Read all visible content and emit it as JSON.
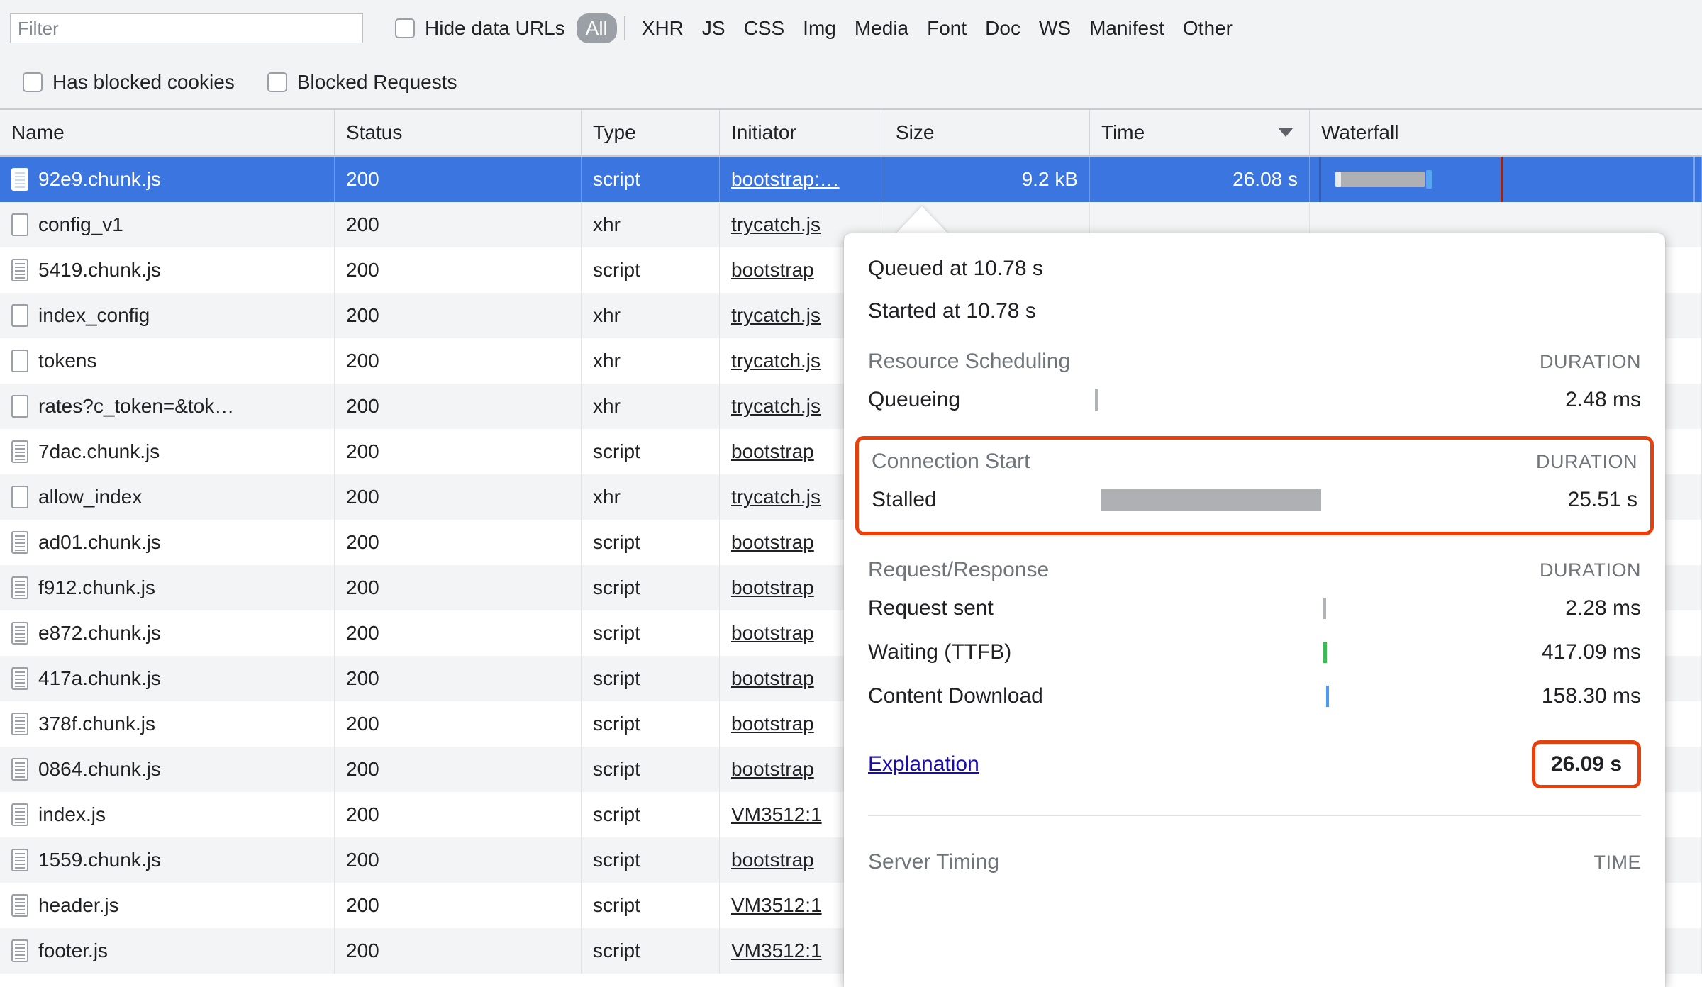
{
  "toolbar": {
    "filter": {
      "placeholder": "Filter",
      "value": ""
    },
    "hide_data_urls_label": "Hide data URLs",
    "type_filters": [
      "All",
      "XHR",
      "JS",
      "CSS",
      "Img",
      "Media",
      "Font",
      "Doc",
      "WS",
      "Manifest",
      "Other"
    ],
    "active_type_filter": "All",
    "has_blocked_cookies_label": "Has blocked cookies",
    "blocked_requests_label": "Blocked Requests"
  },
  "table": {
    "columns": [
      "Name",
      "Status",
      "Type",
      "Initiator",
      "Size",
      "Time",
      "Waterfall"
    ],
    "sorted_column": "Time",
    "sort_direction": "descending",
    "rows": [
      {
        "name": "92e9.chunk.js",
        "status": "200",
        "type": "script",
        "initiator": "bootstrap:…",
        "size": "9.2 kB",
        "time": "26.08 s",
        "icon": "script-file-icon",
        "selected": true
      },
      {
        "name": "config_v1",
        "status": "200",
        "type": "xhr",
        "initiator": "trycatch.js",
        "size": "",
        "time": "",
        "icon": "blank-file-icon",
        "selected": false
      },
      {
        "name": "5419.chunk.js",
        "status": "200",
        "type": "script",
        "initiator": "bootstrap",
        "size": "",
        "time": "",
        "icon": "script-file-icon",
        "selected": false
      },
      {
        "name": "index_config",
        "status": "200",
        "type": "xhr",
        "initiator": "trycatch.js",
        "size": "",
        "time": "",
        "icon": "blank-file-icon",
        "selected": false
      },
      {
        "name": "tokens",
        "status": "200",
        "type": "xhr",
        "initiator": "trycatch.js",
        "size": "",
        "time": "",
        "icon": "blank-file-icon",
        "selected": false
      },
      {
        "name": "rates?c_token=&tok…",
        "status": "200",
        "type": "xhr",
        "initiator": "trycatch.js",
        "size": "",
        "time": "",
        "icon": "blank-file-icon",
        "selected": false
      },
      {
        "name": "7dac.chunk.js",
        "status": "200",
        "type": "script",
        "initiator": "bootstrap",
        "size": "",
        "time": "",
        "icon": "script-file-icon",
        "selected": false
      },
      {
        "name": "allow_index",
        "status": "200",
        "type": "xhr",
        "initiator": "trycatch.js",
        "size": "",
        "time": "",
        "icon": "blank-file-icon",
        "selected": false
      },
      {
        "name": "ad01.chunk.js",
        "status": "200",
        "type": "script",
        "initiator": "bootstrap",
        "size": "",
        "time": "",
        "icon": "script-file-icon",
        "selected": false
      },
      {
        "name": "f912.chunk.js",
        "status": "200",
        "type": "script",
        "initiator": "bootstrap",
        "size": "",
        "time": "",
        "icon": "script-file-icon",
        "selected": false
      },
      {
        "name": "e872.chunk.js",
        "status": "200",
        "type": "script",
        "initiator": "bootstrap",
        "size": "",
        "time": "",
        "icon": "script-file-icon",
        "selected": false
      },
      {
        "name": "417a.chunk.js",
        "status": "200",
        "type": "script",
        "initiator": "bootstrap",
        "size": "",
        "time": "",
        "icon": "script-file-icon",
        "selected": false
      },
      {
        "name": "378f.chunk.js",
        "status": "200",
        "type": "script",
        "initiator": "bootstrap",
        "size": "",
        "time": "",
        "icon": "script-file-icon",
        "selected": false
      },
      {
        "name": "0864.chunk.js",
        "status": "200",
        "type": "script",
        "initiator": "bootstrap",
        "size": "",
        "time": "",
        "icon": "script-file-icon",
        "selected": false
      },
      {
        "name": "index.js",
        "status": "200",
        "type": "script",
        "initiator": "VM3512:1",
        "size": "",
        "time": "",
        "icon": "script-file-icon",
        "selected": false
      },
      {
        "name": "1559.chunk.js",
        "status": "200",
        "type": "script",
        "initiator": "bootstrap",
        "size": "",
        "time": "",
        "icon": "script-file-icon",
        "selected": false
      },
      {
        "name": "header.js",
        "status": "200",
        "type": "script",
        "initiator": "VM3512:1",
        "size": "",
        "time": "",
        "icon": "script-file-icon",
        "selected": false
      },
      {
        "name": "footer.js",
        "status": "200",
        "type": "script",
        "initiator": "VM3512:1",
        "size": "",
        "time": "",
        "icon": "script-file-icon",
        "selected": false
      }
    ]
  },
  "popover": {
    "queued_at": "Queued at 10.78 s",
    "started_at": "Started at 10.78 s",
    "duration_header": "DURATION",
    "time_header": "TIME",
    "sections": [
      {
        "title": "Resource Scheduling",
        "highlighted": false,
        "rows": [
          {
            "label": "Queueing",
            "value": "2.48 ms",
            "bar_color": "#b0b3b6",
            "bar_left_pct": 0,
            "bar_width_pct": 0.6
          }
        ]
      },
      {
        "title": "Connection Start",
        "highlighted": true,
        "rows": [
          {
            "label": "Stalled",
            "value": "25.51 s",
            "bar_color": "#aeb0b3",
            "bar_left_pct": 0.6,
            "bar_width_pct": 61
          }
        ]
      },
      {
        "title": "Request/Response",
        "highlighted": false,
        "rows": [
          {
            "label": "Request sent",
            "value": "2.28 ms",
            "bar_color": "#b0b3b6",
            "bar_left_pct": 62,
            "bar_width_pct": 0.6
          },
          {
            "label": "Waiting (TTFB)",
            "value": "417.09 ms",
            "bar_color": "#3cba54",
            "bar_left_pct": 62,
            "bar_width_pct": 0.9
          },
          {
            "label": "Content Download",
            "value": "158.30 ms",
            "bar_color": "#4a9bf5",
            "bar_left_pct": 62.6,
            "bar_width_pct": 0.7
          }
        ]
      }
    ],
    "explanation_label": "Explanation",
    "total_time": "26.09 s",
    "server_timing_title": "Server Timing",
    "highlight_color": "#e8400c"
  }
}
